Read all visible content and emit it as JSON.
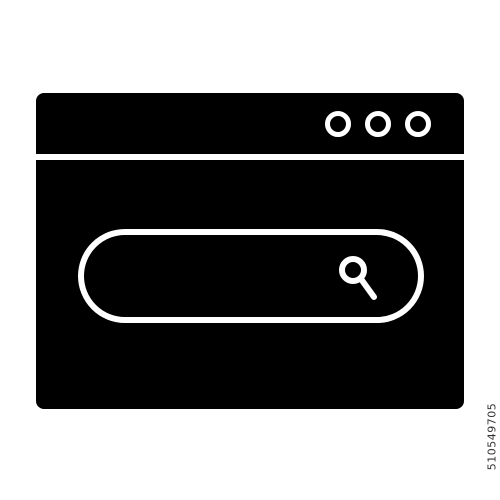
{
  "icon": {
    "name": "browser-search-icon",
    "colors": {
      "fill": "#000000",
      "background": "#ffffff",
      "stroke": "#ffffff"
    },
    "window_control_icons": [
      "circle-icon",
      "circle-icon",
      "circle-icon"
    ],
    "search_icon": "magnifier-icon"
  },
  "watermark": {
    "stock_id": "510549705"
  }
}
